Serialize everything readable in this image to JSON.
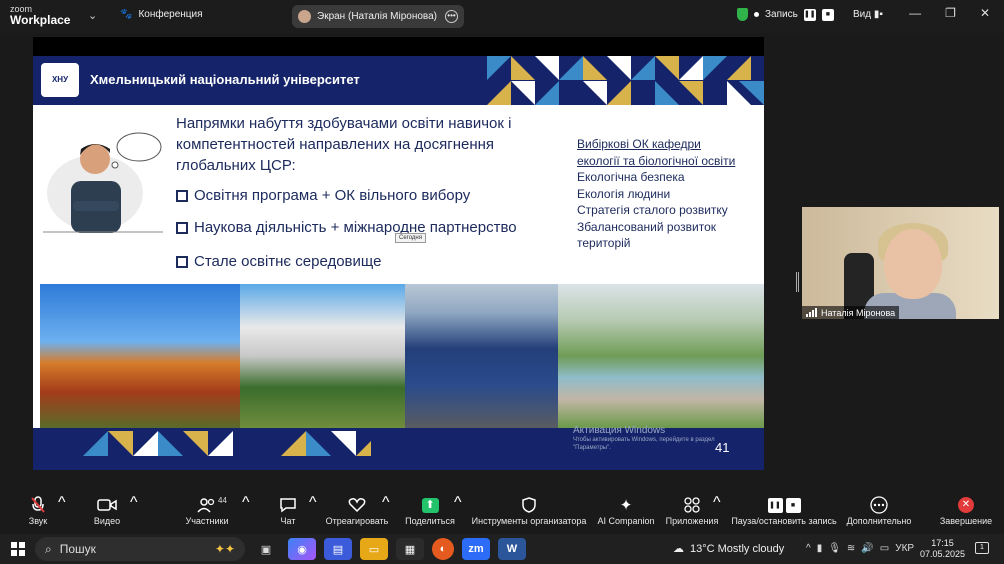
{
  "topbar": {
    "brand_line1": "zoom",
    "brand_line2": "Workplace",
    "conference_label": "Конференция",
    "screen_share_label": "Экран (Наталія Міронова)",
    "record_label": "Запись",
    "view_label": "Вид"
  },
  "slide": {
    "university": "Хмельницький національний університет",
    "logo_text": "ХНУ",
    "heading": "Напрямки набуття здобувачами освіти навичок і компетентностей направлених на досягнення глобальних ЦСР:",
    "bullets": [
      "Освітня програма + ОК вільного вибору",
      "Наукова діяльність + міжнародне партнерство",
      "Стале освітнє середовище"
    ],
    "tooltip": "Сегодня",
    "side_title_1": "Вибіркові ОК кафедри",
    "side_title_2": "екології та біологічної освіти",
    "side_items": [
      "Екологічна безпека",
      "Екологія людини",
      "Стратегія сталого розвитку",
      "Збалансований розвиток",
      "територій"
    ],
    "activate_title": "Активация Windows",
    "activate_text": "Чтобы активировать Windows, перейдите в раздел \"Параметры\".",
    "slide_number": "41",
    "colors": {
      "navy": "#15246a",
      "gold": "#d8b24a",
      "teal": "#3a8bc8"
    }
  },
  "participant": {
    "name": "Наталія Міронова"
  },
  "toolbar": {
    "mic": "Звук",
    "video": "Видео",
    "participants": "Участники",
    "participants_count": "44",
    "chat": "Чат",
    "react": "Отреагировать",
    "share": "Поделиться",
    "host_tools": "Инструменты организатора",
    "ai": "AI Companion",
    "apps": "Приложения",
    "pause_record": "Пауза/остановить запись",
    "more": "Дополнительно",
    "end": "Завершение"
  },
  "taskbar": {
    "search_placeholder": "Пошук",
    "weather": "13°C  Mostly cloudy",
    "lang": "УКР",
    "time": "17:15",
    "date": "07.05.2025",
    "notif_count": "1"
  }
}
